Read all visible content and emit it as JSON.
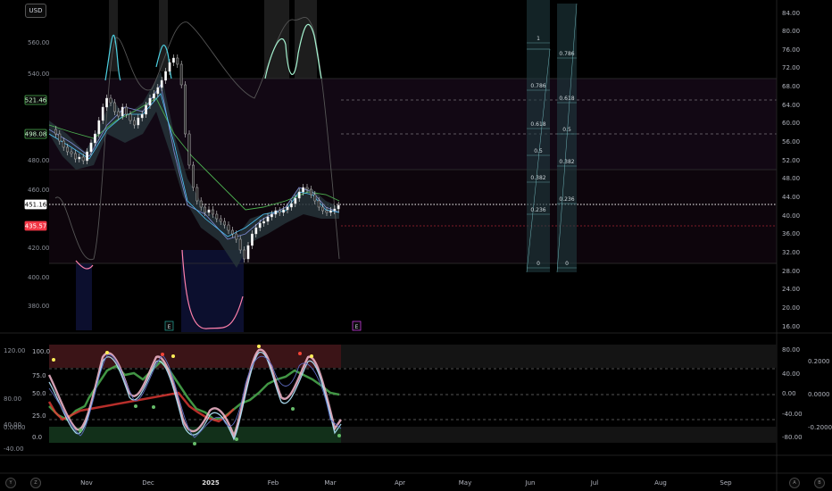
{
  "header": {
    "currency": "USD"
  },
  "price_axis_right": [
    "84.00",
    "80.00",
    "76.00",
    "72.00",
    "68.00",
    "64.00",
    "60.00",
    "56.00",
    "52.00",
    "48.00",
    "44.00",
    "40.00",
    "36.00",
    "32.00",
    "28.00",
    "24.00",
    "20.00",
    "16.00"
  ],
  "price_axis_left": [
    "560.00",
    "540.00",
    "480.00",
    "460.00",
    "420.00",
    "400.00",
    "380.00"
  ],
  "price_tags": [
    {
      "value": "521.46",
      "color": "#4caf50"
    },
    {
      "value": "498.08",
      "color": "#4caf50"
    },
    {
      "value": "451.16",
      "color": "#ffffff"
    },
    {
      "value": "435.57",
      "color": "#f23645"
    }
  ],
  "osc_axis_left": [
    "120.00",
    "80.00",
    "40.00",
    "0.0000",
    "-40.00"
  ],
  "osc_levels": [
    "100.0",
    "75.0",
    "50.0",
    "25.0",
    "0.0"
  ],
  "osc_axis_mid": [
    "80.00",
    "40.00",
    "0.00",
    "-40.00",
    "-80.00"
  ],
  "osc_axis_right": [
    "0.2000",
    "0.0000",
    "-0.2000"
  ],
  "time_axis": [
    "Nov",
    "Dec",
    "2025",
    "Feb",
    "Mar",
    "Apr",
    "May",
    "Jun",
    "Jul",
    "Aug",
    "Sep"
  ],
  "fib_left": [
    "1",
    "0.786",
    "0.618",
    "0.5",
    "0.382",
    "0.236",
    "0"
  ],
  "fib_right": [
    "0.786",
    "0.618",
    "0.5",
    "0.382",
    "0.236",
    "0"
  ],
  "event_markers": [
    "E",
    "E"
  ],
  "bottom_buttons": [
    "Y",
    "Z",
    "A",
    "B"
  ],
  "colors": {
    "up": "#26a69a",
    "down": "#ef5350",
    "green_line": "#4caf50",
    "cyan": "#4dd0e1",
    "pink": "#ff80ab"
  }
}
